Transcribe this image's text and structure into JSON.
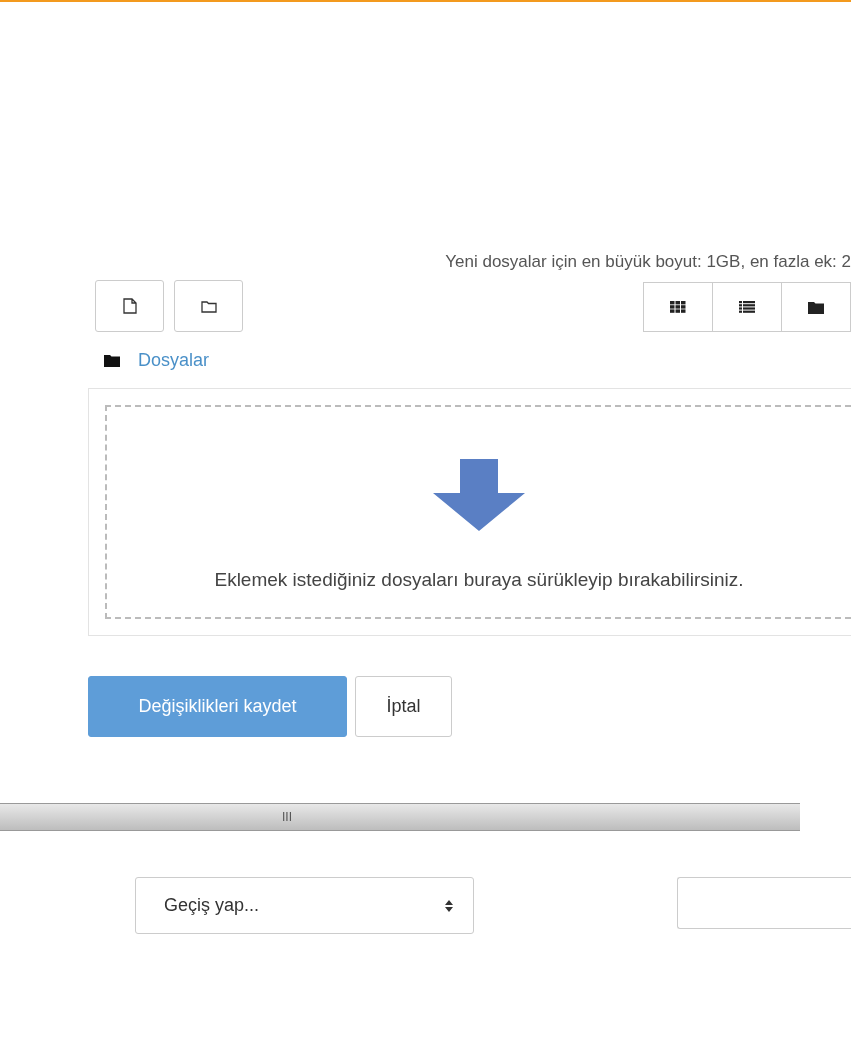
{
  "upload_info": "Yeni dosyalar için en büyük boyut: 1GB, en fazla ek: 2",
  "file_actions": [
    {
      "kind": "file"
    },
    {
      "kind": "folder"
    }
  ],
  "view_modes": [
    {
      "kind": "grid"
    },
    {
      "kind": "list"
    },
    {
      "kind": "tree"
    }
  ],
  "breadcrumb": "Dosyalar",
  "dropzone": {
    "message": "Eklemek istediğiniz dosyaları buraya sürükleyip bırakabilirsiniz."
  },
  "buttons": [
    {
      "label": "Değişiklikleri kaydet",
      "kind": "primary"
    },
    {
      "label": "İptal",
      "kind": "secondary"
    }
  ],
  "splitter": {
    "grip": "III"
  },
  "jump_select": {
    "value": "Geçiş yap..."
  }
}
